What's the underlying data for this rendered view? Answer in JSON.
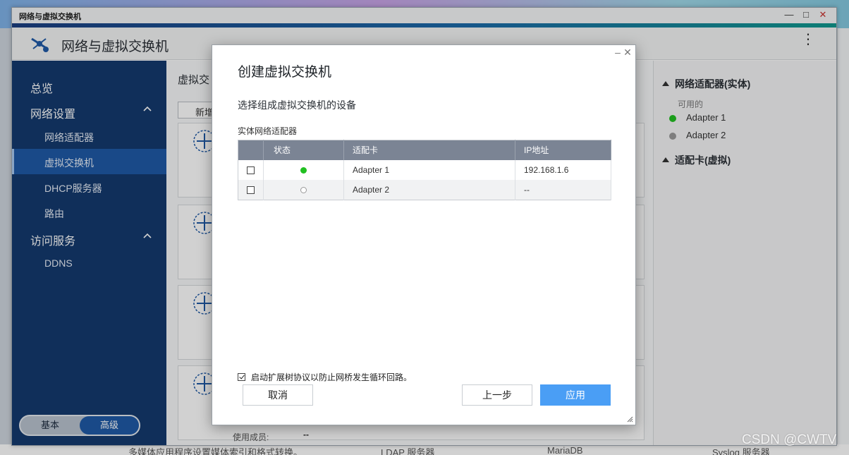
{
  "window": {
    "title": "网络与虚拟交换机",
    "app_title": "网络与虚拟交换机"
  },
  "sidebar": {
    "items": [
      {
        "label": "总览"
      },
      {
        "label": "网络设置"
      },
      {
        "label": "网络适配器"
      },
      {
        "label": "虚拟交换机"
      },
      {
        "label": "DHCP服务器"
      },
      {
        "label": "路由"
      },
      {
        "label": "访问服务"
      },
      {
        "label": "DDNS"
      }
    ],
    "active": "虚拟交换机",
    "mode": {
      "basic": "基本",
      "advanced": "高级",
      "selected": "高级"
    }
  },
  "content": {
    "section_title": "虚拟交",
    "new_button": "新增",
    "member_label": "使用成员:",
    "member_value": "--"
  },
  "right_panel": {
    "physical_heading": "网络适配器(实体)",
    "available_label": "可用的",
    "adapters": [
      {
        "name": "Adapter 1",
        "color": "#21c021"
      },
      {
        "name": "Adapter 2",
        "color": "#9a9a9a"
      }
    ],
    "virtual_heading": "适配卡(虚拟)"
  },
  "dialog": {
    "title": "创建虚拟交换机",
    "subtitle": "选择组成虚拟交换机的设备",
    "group_label": "实体网络适配器",
    "columns": [
      "",
      "状态",
      "适配卡",
      "IP地址"
    ],
    "rows": [
      {
        "checked": false,
        "status": "connected",
        "adapter": "Adapter 1",
        "ip": "192.168.1.6"
      },
      {
        "checked": false,
        "status": "disconnected",
        "adapter": "Adapter 2",
        "ip": "--"
      }
    ],
    "stp_label": "启动扩展树协议以防止网桥发生循环回路。",
    "stp_checked": true,
    "cancel": "取消",
    "back": "上一步",
    "apply": "应用"
  },
  "background": {
    "bottom_items": [
      "多媒体应用程序设置媒体索引和格式转换。",
      "LDAP 服务器",
      "MariaDB",
      "Syslog 服务器"
    ]
  },
  "watermark": "CSDN @CWTV",
  "colors": {
    "accent": "#1f5aa6",
    "primary_button": "#4a9ef5",
    "sidebar_bg": "#143a6e"
  }
}
